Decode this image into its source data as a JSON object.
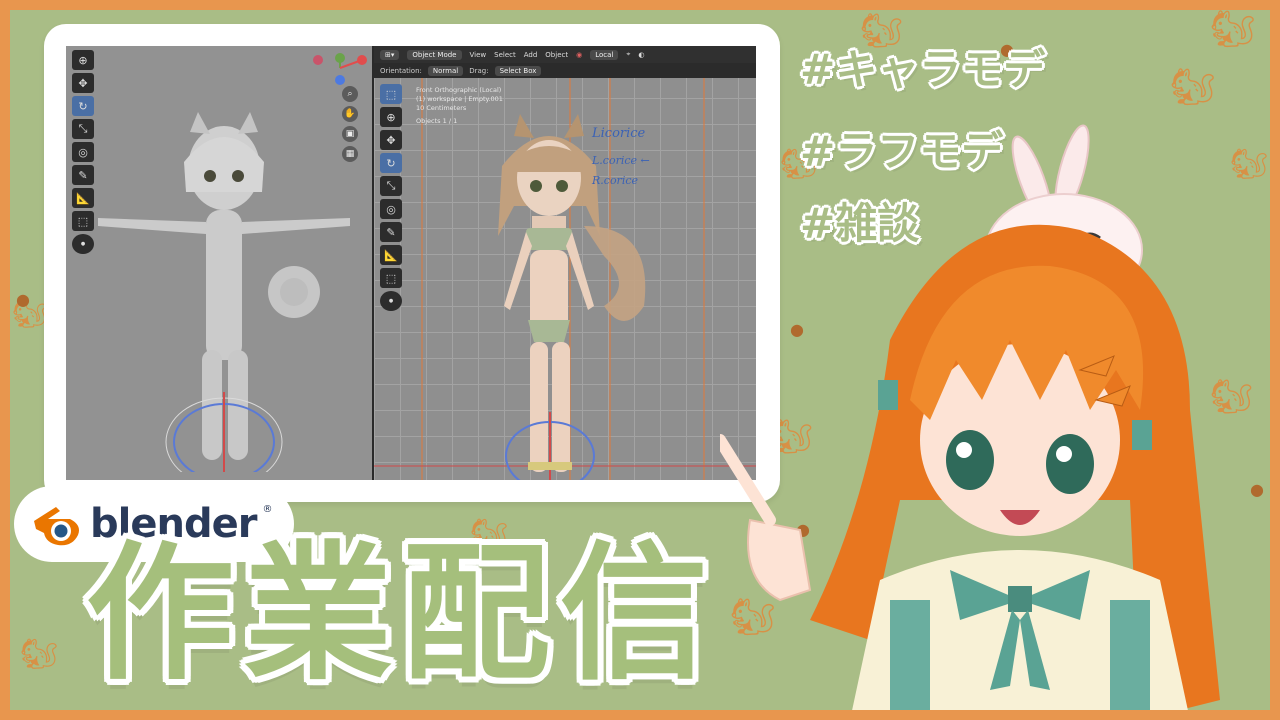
{
  "blender_ui": {
    "header": {
      "mode": "Object Mode",
      "menu_view": "View",
      "menu_select": "Select",
      "menu_add": "Add",
      "menu_object": "Object",
      "transform_space": "Local"
    },
    "subheader": {
      "orientation_label": "Orientation:",
      "orientation_value": "Normal",
      "drag_label": "Drag:",
      "drag_value": "Select Box"
    },
    "info": {
      "line1": "Front Orthographic (Local)",
      "line2": "(1) workspace | Empty.001",
      "line3": "10 Centimeters",
      "line4": "Objects   1 / 1"
    },
    "notes": {
      "note1": "Licorice",
      "note2": "L.corice ←",
      "note3": "R.corice"
    }
  },
  "hashtags": {
    "tag1": "#キャラモデ",
    "tag2": "#ラフモデ",
    "tag3": "#雑談"
  },
  "logo": {
    "text": "blender",
    "reg": "®"
  },
  "title": "作業配信",
  "colors": {
    "background": "#a9bd86",
    "border": "#e8964e",
    "title_fill": "#a5bf7c",
    "blender_orange": "#ea7600",
    "blender_blue": "#265787"
  }
}
